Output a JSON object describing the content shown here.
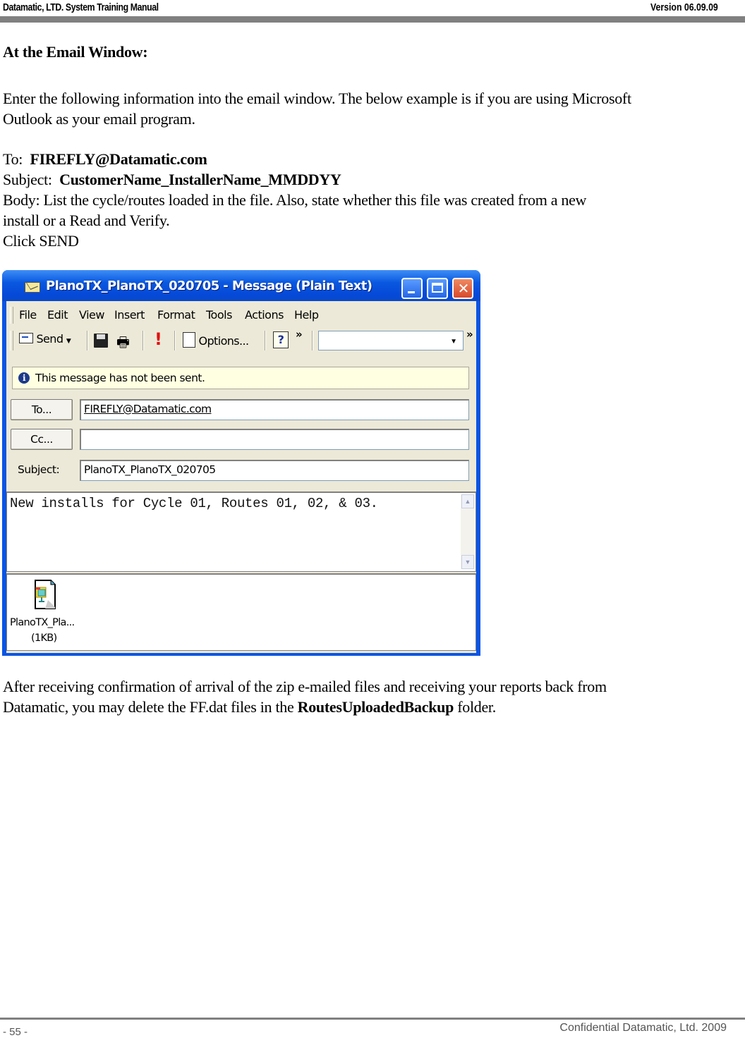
{
  "header": {
    "left": "Datamatic, LTD. System Training  Manual",
    "right": "Version 06.09.09"
  },
  "section_title": "At the Email Window:",
  "intro_line1": "Enter the following information into the email window. The below example is if you are using Microsoft",
  "intro_line2": "Outlook as your email program.",
  "fields": {
    "to_label": "To:",
    "to_value": "FIREFLY@Datamatic.com",
    "subject_label": "Subject:",
    "subject_value": "CustomerName_InstallerName_MMDDYY",
    "body_line1": "Body:  List the cycle/routes loaded in the file.  Also, state whether this file was created from a new",
    "body_line2": "install or a Read and Verify.",
    "click": "Click SEND"
  },
  "email_window": {
    "title": "PlanoTX_PlanoTX_020705 - Message (Plain Text)",
    "menu": [
      "File",
      "Edit",
      "View",
      "Insert",
      "Format",
      "Tools",
      "Actions",
      "Help"
    ],
    "toolbar": {
      "send": "Send",
      "options": "Options...",
      "chevron": "»"
    },
    "info": "This message has not been sent.",
    "to_button": "To...",
    "cc_button": "Cc...",
    "subject_label": "Subject:",
    "to_value": "FIREFLY@Datamatic.com",
    "cc_value": "",
    "subject_value": "PlanoTX_PlanoTX_020705",
    "body_text": "New installs for Cycle 01, Routes 01, 02, & 03.",
    "attachment": {
      "name": "PlanoTX_Pla...",
      "size": "(1KB)"
    }
  },
  "closing_line1": "After receiving confirmation of arrival of the zip e-mailed files and receiving your reports back from",
  "closing_line2_pre": "Datamatic, you may delete the FF.dat files in the ",
  "closing_line2_bold": "RoutesUploadedBackup",
  "closing_line2_post": " folder.",
  "footer": {
    "page": "- 55 -",
    "right": "Confidential Datamatic, Ltd. 2009"
  }
}
